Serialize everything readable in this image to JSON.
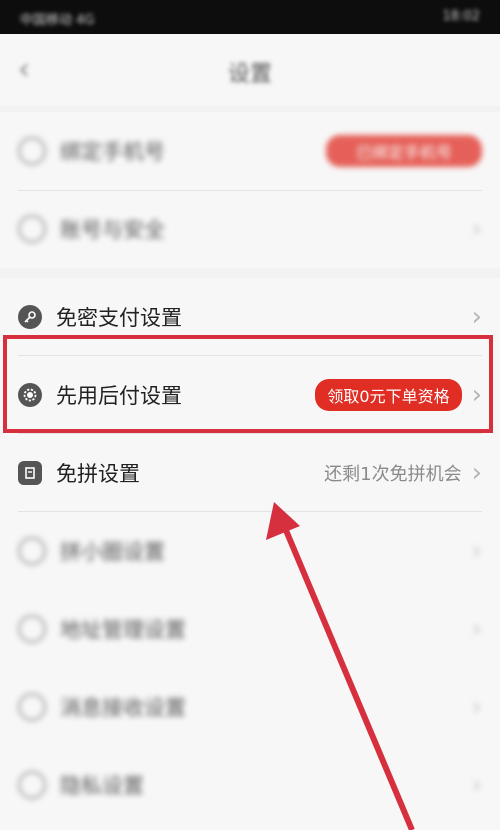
{
  "status_bar": {
    "left": "中国移动 4G",
    "right": "18:02"
  },
  "nav": {
    "title": "设置",
    "back": "‹"
  },
  "top_rows": [
    {
      "label": "绑定手机号",
      "badge": "已绑定手机号"
    },
    {
      "label": "账号与安全"
    }
  ],
  "rows": [
    {
      "label": "免密支付设置"
    },
    {
      "label": "先用后付设置",
      "badge": "领取0元下单资格"
    },
    {
      "label": "免拼设置",
      "hint": "还剩1次免拼机会"
    }
  ],
  "bottom_rows": [
    {
      "label": "拼小圈设置"
    },
    {
      "label": "地址管理设置"
    },
    {
      "label": "消息接收设置"
    },
    {
      "label": "隐私设置"
    }
  ],
  "chevron": "›",
  "colors": {
    "accent": "#e02e24",
    "highlight": "#d6303f"
  }
}
